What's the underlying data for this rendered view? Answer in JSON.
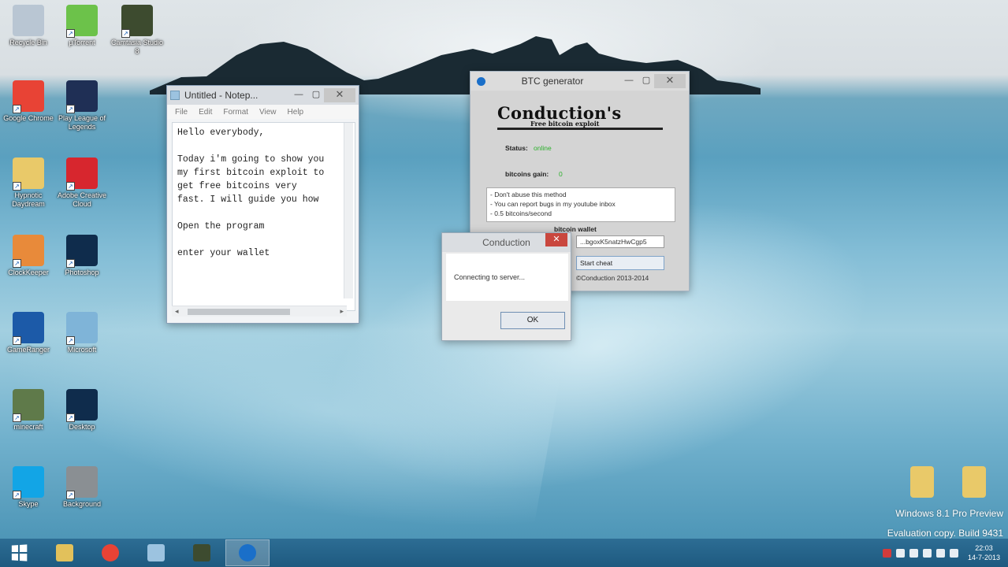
{
  "desktop": {
    "icons": [
      {
        "label": "Recycle Bin",
        "icon": "recycle-bin-icon",
        "color": "#b9c6d3"
      },
      {
        "label": "µTorrent",
        "icon": "utorrent-icon",
        "color": "#6cc24a"
      },
      {
        "label": "Camtasia Studio 8",
        "icon": "camtasia-icon",
        "color": "#3d4b2f"
      },
      {
        "label": "Google Chrome",
        "icon": "chrome-icon",
        "color": "#e84335"
      },
      {
        "label": "Play League of Legends",
        "icon": "league-icon",
        "color": "#1f2f55"
      },
      {
        "label": "Hypnotic Daydream",
        "icon": "folder-icon",
        "color": "#e9c969"
      },
      {
        "label": "Adobe Creative Cloud",
        "icon": "creative-cloud-icon",
        "color": "#d7262e"
      },
      {
        "label": "ClockKeeper",
        "icon": "clockkeeper-icon",
        "color": "#e88a3a"
      },
      {
        "label": "Photoshop",
        "icon": "photoshop-icon",
        "color": "#0f2c4c"
      },
      {
        "label": "GameRanger",
        "icon": "gameranger-icon",
        "color": "#1c5aa8"
      },
      {
        "label": "Microsoft",
        "icon": "microsoft-icon",
        "color": "#7fb4d8"
      },
      {
        "label": "minecraft",
        "icon": "minecraft-icon",
        "color": "#5f7a4a"
      },
      {
        "label": "Desktop",
        "icon": "photoshop-icon",
        "color": "#0f2c4c"
      },
      {
        "label": "Skype",
        "icon": "skype-icon",
        "color": "#12a5e6"
      },
      {
        "label": "Background",
        "icon": "image-file-icon",
        "color": "#8a8f93"
      }
    ],
    "right_icons": [
      {
        "label": "",
        "icon": "folder-icon",
        "color": "#e9c969"
      },
      {
        "label": "",
        "icon": "folder-icon",
        "color": "#e9c969"
      }
    ]
  },
  "notepad": {
    "title": "Untitled - Notep...",
    "menu": [
      "File",
      "Edit",
      "Format",
      "View",
      "Help"
    ],
    "text": "Hello everybody,\n\nToday i'm going to show you\nmy first bitcoin exploit to\nget free bitcoins very\nfast. I will guide you how\n\nOpen the program\n\nenter your wallet"
  },
  "btc": {
    "title": "BTC generator",
    "heading": "Conduction's",
    "subheading": "Free bitcoin exploit",
    "status_label": "Status:",
    "status_value": "online",
    "gain_label": "bitcoins gain:",
    "gain_value": "0",
    "notes": [
      "- Don't abuse this method",
      "- You can report bugs in my youtube inbox",
      "- 0.5 bitcoins/second"
    ],
    "wallet_label": "bitcoin wallet",
    "wallet_value": "...bgoxK5natzHwCgp5",
    "start_label": "Start cheat",
    "credit": "©Conduction 2013-2014"
  },
  "dialog": {
    "title": "Conduction",
    "close": "✕",
    "message": "Connecting to server...",
    "ok_label": "OK"
  },
  "watermark": {
    "line1": "Windows 8.1 Pro Preview",
    "line2": "Evaluation copy. Build 9431"
  },
  "taskbar": {
    "apps": [
      {
        "name": "file-explorer",
        "color": "#e2c15b"
      },
      {
        "name": "chrome",
        "color": "#e84335"
      },
      {
        "name": "notepad",
        "color": "#9cc3e0"
      },
      {
        "name": "camtasia",
        "color": "#3d4b2f"
      },
      {
        "name": "btc-generator",
        "color": "#1a6fc9"
      }
    ],
    "clock_time": "22:03",
    "clock_date": "14-7-2013"
  }
}
